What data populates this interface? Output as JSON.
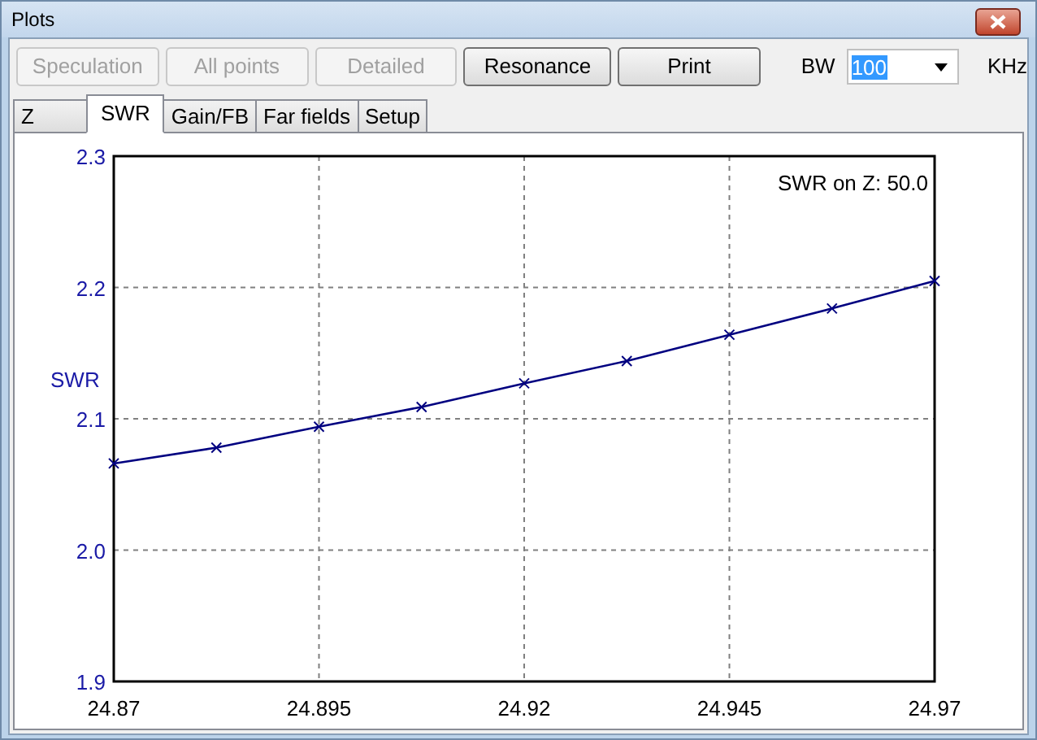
{
  "window": {
    "title": "Plots"
  },
  "buttons": [
    {
      "label": "Speculation",
      "disabled": true
    },
    {
      "label": "All points",
      "disabled": true
    },
    {
      "label": "Detailed",
      "disabled": true
    },
    {
      "label": "Resonance",
      "disabled": false
    },
    {
      "label": "Print",
      "disabled": false
    }
  ],
  "bandwidth": {
    "label": "BW",
    "value": "100",
    "unit": "KHz"
  },
  "tabs": [
    {
      "label": "Z",
      "selected": false
    },
    {
      "label": "SWR",
      "selected": true
    },
    {
      "label": "Gain/FB",
      "selected": false
    },
    {
      "label": "Far fields",
      "selected": false
    },
    {
      "label": "Setup",
      "selected": false
    }
  ],
  "plot": {
    "chart_data": {
      "type": "line",
      "ylabel": "SWR",
      "x": [
        24.87,
        24.8825,
        24.895,
        24.9075,
        24.92,
        24.9325,
        24.945,
        24.9575,
        24.97
      ],
      "grid": true,
      "series": [
        {
          "color": "#000080",
          "marker": "x",
          "values": [
            2.066,
            2.078,
            2.094,
            2.109,
            2.127,
            2.144,
            2.164,
            2.184,
            2.205
          ]
        }
      ],
      "xlim": [
        24.87,
        24.97
      ],
      "ylim": [
        1.9,
        2.3
      ],
      "xticks": [
        {
          "value": 24.87,
          "label": "24.87"
        },
        {
          "value": 24.895,
          "label": "24.895"
        },
        {
          "value": 24.92,
          "label": "24.92"
        },
        {
          "value": 24.945,
          "label": "24.945"
        },
        {
          "value": 24.97,
          "label": "24.97"
        }
      ],
      "yticks": [
        {
          "value": 1.9,
          "label": "1.9"
        },
        {
          "value": 2.0,
          "label": "2.0"
        },
        {
          "value": 2.1,
          "label": "2.1"
        },
        {
          "value": 2.2,
          "label": "2.2"
        },
        {
          "value": 2.3,
          "label": "2.3"
        }
      ],
      "annotations": [
        "SWR on Z: 50.0"
      ]
    }
  }
}
